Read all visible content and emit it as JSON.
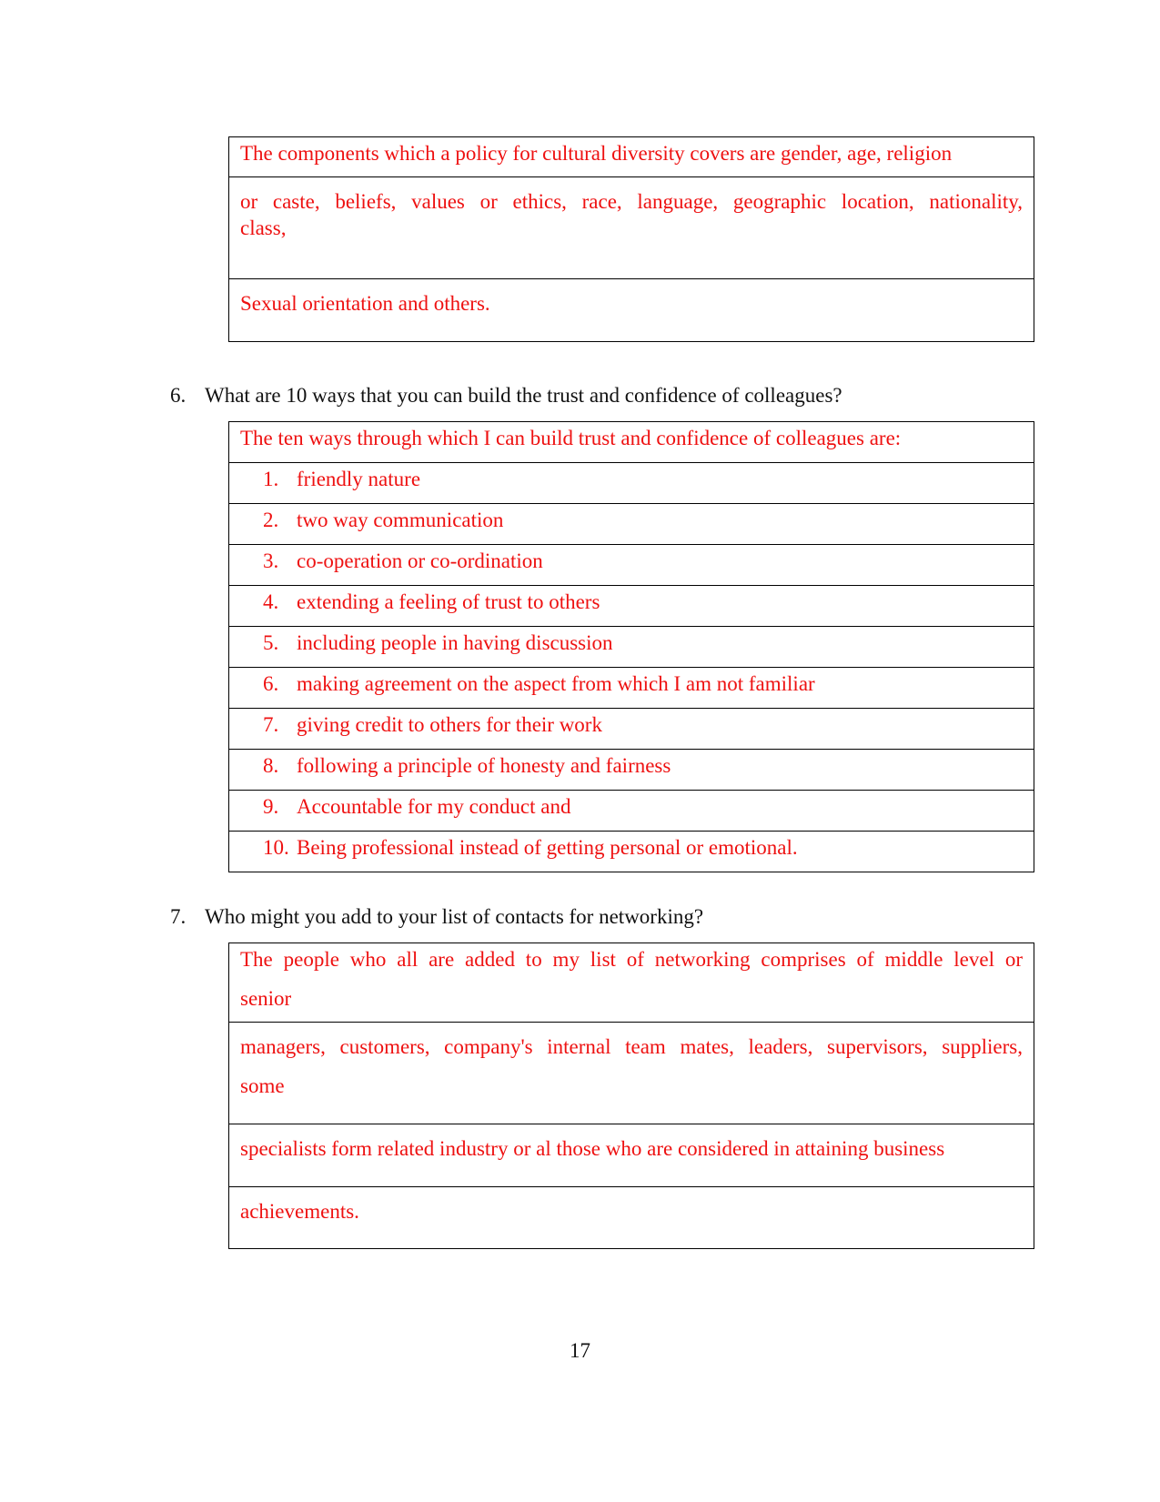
{
  "section5": {
    "answer_rows": [
      "The components which a policy for cultural diversity covers are gender, age, religion",
      "or caste, beliefs, values or ethics, race, language, geographic location, nationality,",
      "class,",
      "Sexual orientation and others."
    ]
  },
  "question6": {
    "number": "6.",
    "text": "What are 10 ways that you can build the trust and confidence of colleagues?",
    "intro": "The ten ways through which I can build trust and confidence of colleagues are:",
    "items": [
      {
        "n": "1.",
        "text": "friendly nature"
      },
      {
        "n": "2.",
        "text": "two way communication"
      },
      {
        "n": "3.",
        "text": "co-operation or co-ordination"
      },
      {
        "n": "4.",
        "text": "extending a feeling of trust to others"
      },
      {
        "n": "5.",
        "text": "including people in having discussion"
      },
      {
        "n": "6.",
        "text": "making agreement on the aspect from which I am not familiar"
      },
      {
        "n": "7.",
        "text": "giving credit to others for their work"
      },
      {
        "n": "8.",
        "text": "following a principle of honesty and fairness"
      },
      {
        "n": "9.",
        "text": "Accountable for my conduct and"
      },
      {
        "n": "10.",
        "text": "Being professional instead of getting personal or emotional."
      }
    ]
  },
  "question7": {
    "number": "7.",
    "text": "Who might you add to your list of contacts for networking?",
    "answer_rows": [
      {
        "line1": "The people who all are added to my list of networking comprises of middle level or",
        "line2": "senior"
      },
      {
        "line1": "managers, customers, company's internal team mates, leaders, supervisors, suppliers,",
        "line2": "some"
      },
      {
        "line1": "specialists form related industry or al those who are considered in attaining business",
        "line2": ""
      },
      {
        "line1": "achievements.",
        "line2": ""
      }
    ]
  },
  "footer": {
    "page_number": "17"
  },
  "colors": {
    "answer_text": "#ee1111",
    "question_text": "#111111",
    "border": "#000000"
  }
}
